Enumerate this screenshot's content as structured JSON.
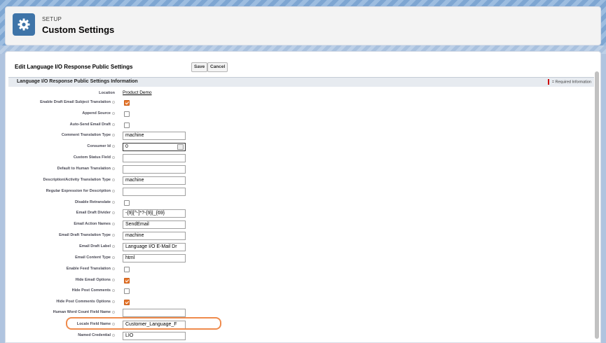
{
  "header": {
    "setup_label": "SETUP",
    "title": "Custom Settings",
    "icon": "gear-icon"
  },
  "page_block": {
    "title": "Edit Language I/O Response Public Settings",
    "save_label": "Save",
    "cancel_label": "Cancel"
  },
  "section": {
    "title": "Language I/O Response Public Settings Information",
    "required_legend": "= Required Information"
  },
  "location": {
    "label": "Location",
    "value": "Product Demo"
  },
  "fields": [
    {
      "label": "Enable Draft Email Subject Translation",
      "type": "checkbox",
      "checked": true
    },
    {
      "label": "Append Source",
      "type": "checkbox",
      "checked": false
    },
    {
      "label": "Auto-Send Email Draft",
      "type": "checkbox",
      "checked": false
    },
    {
      "label": "Comment Translation Type",
      "type": "text",
      "value": "machine",
      "required": true
    },
    {
      "label": "Consumer Id",
      "type": "lookup",
      "value": "0",
      "required": true
    },
    {
      "label": "Custom Status Field",
      "type": "text",
      "value": "",
      "required": false
    },
    {
      "label": "Default to Human Translation",
      "type": "text",
      "value": "",
      "required": false
    },
    {
      "label": "Description/Activity Translation Type",
      "type": "text",
      "value": "machine",
      "required": true
    },
    {
      "label": "Regular Expression for Description",
      "type": "text",
      "value": "",
      "required": false
    },
    {
      "label": "Disable Retranslate",
      "type": "checkbox",
      "checked": false
    },
    {
      "label": "Email Draft Divider",
      "type": "text",
      "value": "-{9}[^-]*?-{9}|_{69}",
      "required": false
    },
    {
      "label": "Email Action Names",
      "type": "text",
      "value": "SendEmail",
      "required": false
    },
    {
      "label": "Email Draft Translation Type",
      "type": "text",
      "value": "machine",
      "required": true
    },
    {
      "label": "Email Draft Label",
      "type": "text",
      "value": "Language I/O E-Mail Dr",
      "required": false
    },
    {
      "label": "Email Content Type",
      "type": "text",
      "value": "html",
      "required": true
    },
    {
      "label": "Enable Feed Translation",
      "type": "checkbox",
      "checked": false
    },
    {
      "label": "Hide Email Options",
      "type": "checkbox",
      "checked": true
    },
    {
      "label": "Hide Post Comments",
      "type": "checkbox",
      "checked": false
    },
    {
      "label": "Hide Post Comments Options",
      "type": "checkbox",
      "checked": true
    },
    {
      "label": "Human Word Count Field Name",
      "type": "text",
      "value": "",
      "required": false
    },
    {
      "label": "Locale Field Name",
      "type": "text",
      "value": "Customer_Language_F",
      "required": true
    },
    {
      "label": "Named Credential",
      "type": "text",
      "value": "LIO",
      "required": true
    }
  ]
}
